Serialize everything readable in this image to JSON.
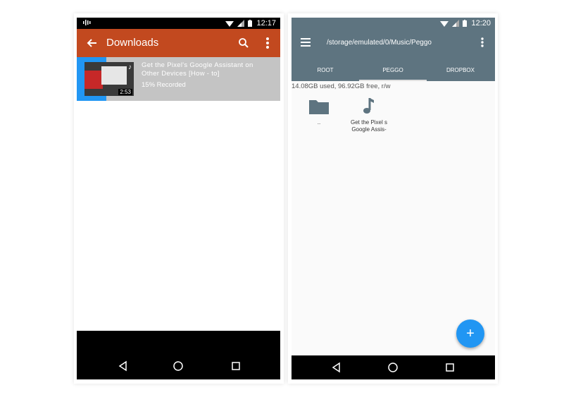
{
  "left_phone": {
    "status_bar": {
      "time": "12:17"
    },
    "toolbar": {
      "title": "Downloads"
    },
    "download_item": {
      "title": "Get the Pixel's Google Assistant on Other Devices [How - to]",
      "status": "15% Recorded",
      "duration": "2:53"
    }
  },
  "right_phone": {
    "status_bar": {
      "time": "12:20"
    },
    "header": {
      "path": "/storage/emulated/0/Music/Peggo"
    },
    "tabs": [
      {
        "label": "ROOT"
      },
      {
        "label": "PEGGO"
      },
      {
        "label": "DROPBOX"
      }
    ],
    "storage_info": "14.08GB used, 96.92GB free, r/w",
    "files": [
      {
        "name": "..",
        "icon": "folder-icon"
      },
      {
        "name": "Get the Pixel s Google Assis-",
        "icon": "music-note-icon"
      }
    ],
    "fab": {
      "label": "+"
    }
  },
  "colors": {
    "left_toolbar": "#c2491f",
    "right_header": "#5e7480",
    "accent": "#2196f3",
    "item_background": "#c4c4c4"
  }
}
